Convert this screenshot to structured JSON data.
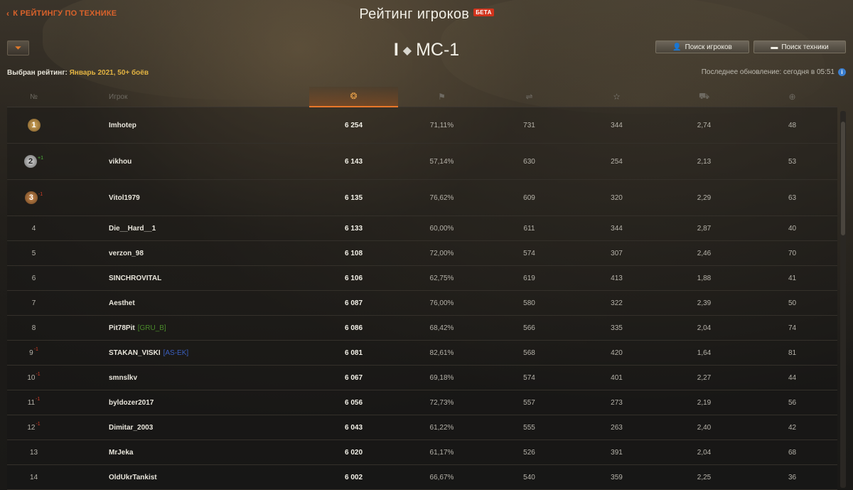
{
  "nav": {
    "back_label": "К РЕЙТИНГУ ПО ТЕХНИКЕ"
  },
  "header": {
    "title": "Рейтинг игроков",
    "beta_label": "БЕТА",
    "vehicle_tier": "I",
    "vehicle_name": "МС-1",
    "search_players_label": "Поиск игроков",
    "search_vehicles_label": "Поиск техники"
  },
  "rating": {
    "label": "Выбран рейтинг:",
    "value": "Январь 2021, 50+ боёв",
    "update_label": "Последнее обновление: сегодня в 05:51"
  },
  "columns": {
    "rank": "№",
    "player": "Игрок",
    "icons": [
      "laurel-icon",
      "flag-icon",
      "damage-icon",
      "star-icon",
      "tank-icon",
      "target-icon"
    ]
  },
  "colors": {
    "accent": "#e8772a",
    "rating_highlight": "#e2b342",
    "delta_down": "#d23c26",
    "delta_up": "#4fb53c",
    "clan_green": "#4a8a2a",
    "clan_blue": "#3a5fbf"
  },
  "rows": [
    {
      "rank": "1",
      "medal": "gold",
      "delta": "",
      "name": "Imhotep",
      "clan": "",
      "clan_color": "",
      "score": "6 254",
      "winrate": "71,11%",
      "c3": "731",
      "c4": "344",
      "c5": "2,74",
      "c6": "48"
    },
    {
      "rank": "2",
      "medal": "silver",
      "delta": "+1",
      "name": "vikhou",
      "clan": "",
      "clan_color": "",
      "score": "6 143",
      "winrate": "57,14%",
      "c3": "630",
      "c4": "254",
      "c5": "2,13",
      "c6": "53"
    },
    {
      "rank": "3",
      "medal": "bronze",
      "delta": "-1",
      "name": "Vitol1979",
      "clan": "",
      "clan_color": "",
      "score": "6 135",
      "winrate": "76,62%",
      "c3": "609",
      "c4": "320",
      "c5": "2,29",
      "c6": "63"
    },
    {
      "rank": "4",
      "medal": "",
      "delta": "",
      "name": "Die__Hard__1",
      "clan": "",
      "clan_color": "",
      "score": "6 133",
      "winrate": "60,00%",
      "c3": "611",
      "c4": "344",
      "c5": "2,87",
      "c6": "40"
    },
    {
      "rank": "5",
      "medal": "",
      "delta": "",
      "name": "verzon_98",
      "clan": "",
      "clan_color": "",
      "score": "6 108",
      "winrate": "72,00%",
      "c3": "574",
      "c4": "307",
      "c5": "2,46",
      "c6": "70"
    },
    {
      "rank": "6",
      "medal": "",
      "delta": "",
      "name": "SINCHROVITAL",
      "clan": "",
      "clan_color": "",
      "score": "6 106",
      "winrate": "62,75%",
      "c3": "619",
      "c4": "413",
      "c5": "1,88",
      "c6": "41"
    },
    {
      "rank": "7",
      "medal": "",
      "delta": "",
      "name": "Aesthet",
      "clan": "",
      "clan_color": "",
      "score": "6 087",
      "winrate": "76,00%",
      "c3": "580",
      "c4": "322",
      "c5": "2,39",
      "c6": "50"
    },
    {
      "rank": "8",
      "medal": "",
      "delta": "",
      "name": "Pit78Pit",
      "clan": "[GRU_B]",
      "clan_color": "#4a8a2a",
      "score": "6 086",
      "winrate": "68,42%",
      "c3": "566",
      "c4": "335",
      "c5": "2,04",
      "c6": "74"
    },
    {
      "rank": "9",
      "medal": "",
      "delta": "-1",
      "name": "STAKAN_VISKI",
      "clan": "[AS-EK]",
      "clan_color": "#3a5fbf",
      "score": "6 081",
      "winrate": "82,61%",
      "c3": "568",
      "c4": "420",
      "c5": "1,64",
      "c6": "81"
    },
    {
      "rank": "10",
      "medal": "",
      "delta": "-1",
      "name": "smnslkv",
      "clan": "",
      "clan_color": "",
      "score": "6 067",
      "winrate": "69,18%",
      "c3": "574",
      "c4": "401",
      "c5": "2,27",
      "c6": "44"
    },
    {
      "rank": "11",
      "medal": "",
      "delta": "-1",
      "name": "byldozer2017",
      "clan": "",
      "clan_color": "",
      "score": "6 056",
      "winrate": "72,73%",
      "c3": "557",
      "c4": "273",
      "c5": "2,19",
      "c6": "56"
    },
    {
      "rank": "12",
      "medal": "",
      "delta": "-1",
      "name": "Dimitar_2003",
      "clan": "",
      "clan_color": "",
      "score": "6 043",
      "winrate": "61,22%",
      "c3": "555",
      "c4": "263",
      "c5": "2,40",
      "c6": "42"
    },
    {
      "rank": "13",
      "medal": "",
      "delta": "",
      "name": "MrJeka",
      "clan": "",
      "clan_color": "",
      "score": "6 020",
      "winrate": "61,17%",
      "c3": "526",
      "c4": "391",
      "c5": "2,04",
      "c6": "68"
    },
    {
      "rank": "14",
      "medal": "",
      "delta": "",
      "name": "OldUkrTankist",
      "clan": "",
      "clan_color": "",
      "score": "6 002",
      "winrate": "66,67%",
      "c3": "540",
      "c4": "359",
      "c5": "2,25",
      "c6": "36"
    }
  ]
}
